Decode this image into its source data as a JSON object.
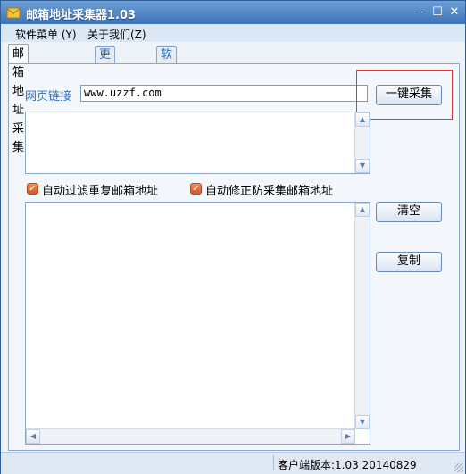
{
  "window": {
    "title": "邮箱地址采集器1.03"
  },
  "menu": {
    "items": [
      "软件菜单 (Y)",
      "关于我们(Z)"
    ]
  },
  "tabs": [
    {
      "label": "邮箱地址采集",
      "active": true
    },
    {
      "label": "更新说明",
      "active": false
    },
    {
      "label": "软件识别码",
      "active": false
    }
  ],
  "form": {
    "url_label": "网页链接",
    "url_value": "www.uzzf.com",
    "collect_button": "一键采集"
  },
  "options": {
    "dedupe_label": "自动过滤重复邮箱地址",
    "dedupe_checked": true,
    "anti_collect_label": "自动修正防采集邮箱地址",
    "anti_collect_checked": true
  },
  "actions": {
    "clear_button": "清空",
    "copy_button": "复制"
  },
  "status": {
    "version_text": "客户端版本:1.03 20140829"
  },
  "colors": {
    "title_bar": "#3c73b8",
    "highlight_box": "#e0353b",
    "checkbox": "#e0703a"
  }
}
